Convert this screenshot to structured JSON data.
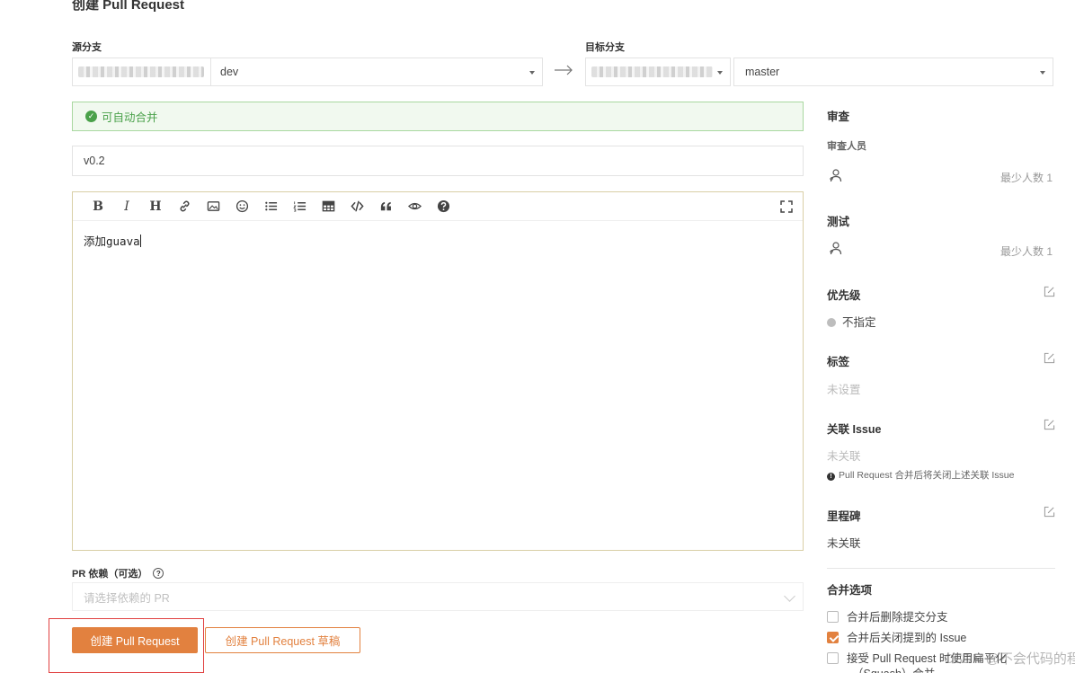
{
  "page": {
    "title": "创建 Pull Request"
  },
  "source": {
    "label": "源分支",
    "branch": "dev"
  },
  "target": {
    "label": "目标分支",
    "branch": "master"
  },
  "merge_status": {
    "text": "可自动合并"
  },
  "form": {
    "title_value": "v0.2",
    "body_value": "添加guava",
    "dependency_label": "PR 依赖（可选）",
    "dependency_placeholder": "请选择依赖的 PR"
  },
  "toolbar": {
    "bold": "B",
    "italic": "I",
    "heading": "H",
    "items": [
      "bold",
      "italic",
      "heading",
      "link-icon",
      "image-icon",
      "emoji-icon",
      "bullet-list-icon",
      "ordered-list-icon",
      "table-icon",
      "code-icon",
      "quote-icon",
      "preview-icon",
      "help-icon",
      "fullscreen-icon"
    ]
  },
  "buttons": {
    "create": "创建 Pull Request",
    "create_draft": "创建 Pull Request 草稿"
  },
  "sidebar": {
    "review": {
      "title": "审查",
      "reviewers_label": "审查人员",
      "min_count": "最少人数 1"
    },
    "test": {
      "title": "测试",
      "min_count": "最少人数 1"
    },
    "priority": {
      "title": "优先级",
      "value": "不指定"
    },
    "labels": {
      "title": "标签",
      "value": "未设置"
    },
    "issue": {
      "title": "关联 Issue",
      "value": "未关联",
      "hint": "Pull Request 合并后将关闭上述关联 Issue"
    },
    "milestone": {
      "title": "里程碑",
      "value": "未关联"
    },
    "merge_options": {
      "title": "合并选项",
      "opt1": "合并后删除提交分支",
      "opt2": "合并后关闭提到的 Issue",
      "opt3": "接受 Pull Request 时使用扁平化",
      "opt3_line2": "（Squash）合并"
    }
  },
  "watermark": "CSDN @不会代码的程序猿~~",
  "colors": {
    "accent": "#e2813f",
    "success": "#4aa14a",
    "highlight": "#e04040"
  }
}
